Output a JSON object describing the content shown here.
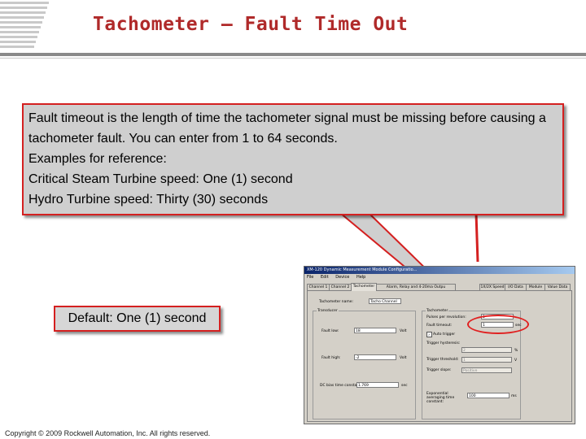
{
  "title": "Tachometer – Fault Time Out",
  "callout": {
    "line1": "Fault timeout is the length of time the tachometer signal must be missing before causing a tachometer fault. You can enter from 1 to 64 seconds.",
    "line2": "Examples for reference:",
    "line3": "Critical Steam Turbine speed: One (1) second",
    "line4": "Hydro Turbine speed: Thirty (30) seconds"
  },
  "default_note": "Default: One (1) second",
  "copyright": "Copyright © 2009 Rockwell Automation, Inc. All rights reserved.",
  "colors": {
    "title": "#b02a2a",
    "callout_border": "#d42020",
    "callout_fill": "#cfcfcf",
    "highlight_ring": "#e02020"
  },
  "dialog": {
    "window_title": "XM-120 Dynamic Measurement Module Configuratio...",
    "menu": [
      "File",
      "Edit",
      "Device",
      "Help"
    ],
    "tabs": [
      "Channel 1",
      "Channel 2",
      "Tachometer",
      "Alarm, Relay and 4-20ma Outpu",
      "1X/2X Speed",
      "I/O Data",
      "Module",
      "Value Data"
    ],
    "tachometer_name_label": "Tachometer name:",
    "tachometer_name_value": "Tacho Channel",
    "transducer_group": "Transducer",
    "fault_low_label": "Fault low:",
    "fault_low_value": "18",
    "fault_low_unit": "Volt",
    "fault_high_label": "Fault high:",
    "fault_high_value": "-2",
    "fault_high_unit": "Volt",
    "dc_bias_label": "DC bias time constant:",
    "dc_bias_value": "1.769",
    "dc_bias_unit": "sec",
    "tachometer_group": "Tachometer",
    "pulses_label": "Pulses per revolution:",
    "pulses_value": "1",
    "fault_timeout_label": "Fault timeout:",
    "fault_timeout_value": "1",
    "fault_timeout_unit": "sec",
    "auto_trigger_label": "Auto trigger",
    "trigger_hysteresis_label": "Trigger hysteresis:",
    "trigger_hysteresis_value": "2",
    "trigger_hysteresis_unit": "%",
    "trigger_threshold_label": "Trigger threshold:",
    "trigger_threshold_value": "1",
    "trigger_threshold_unit": "V",
    "trigger_slope_label": "Trigger slope:",
    "trigger_slope_value": "Positive",
    "averaging_label": "Exponential averaging time constant:",
    "averaging_value": "100",
    "averaging_unit": "ms"
  }
}
